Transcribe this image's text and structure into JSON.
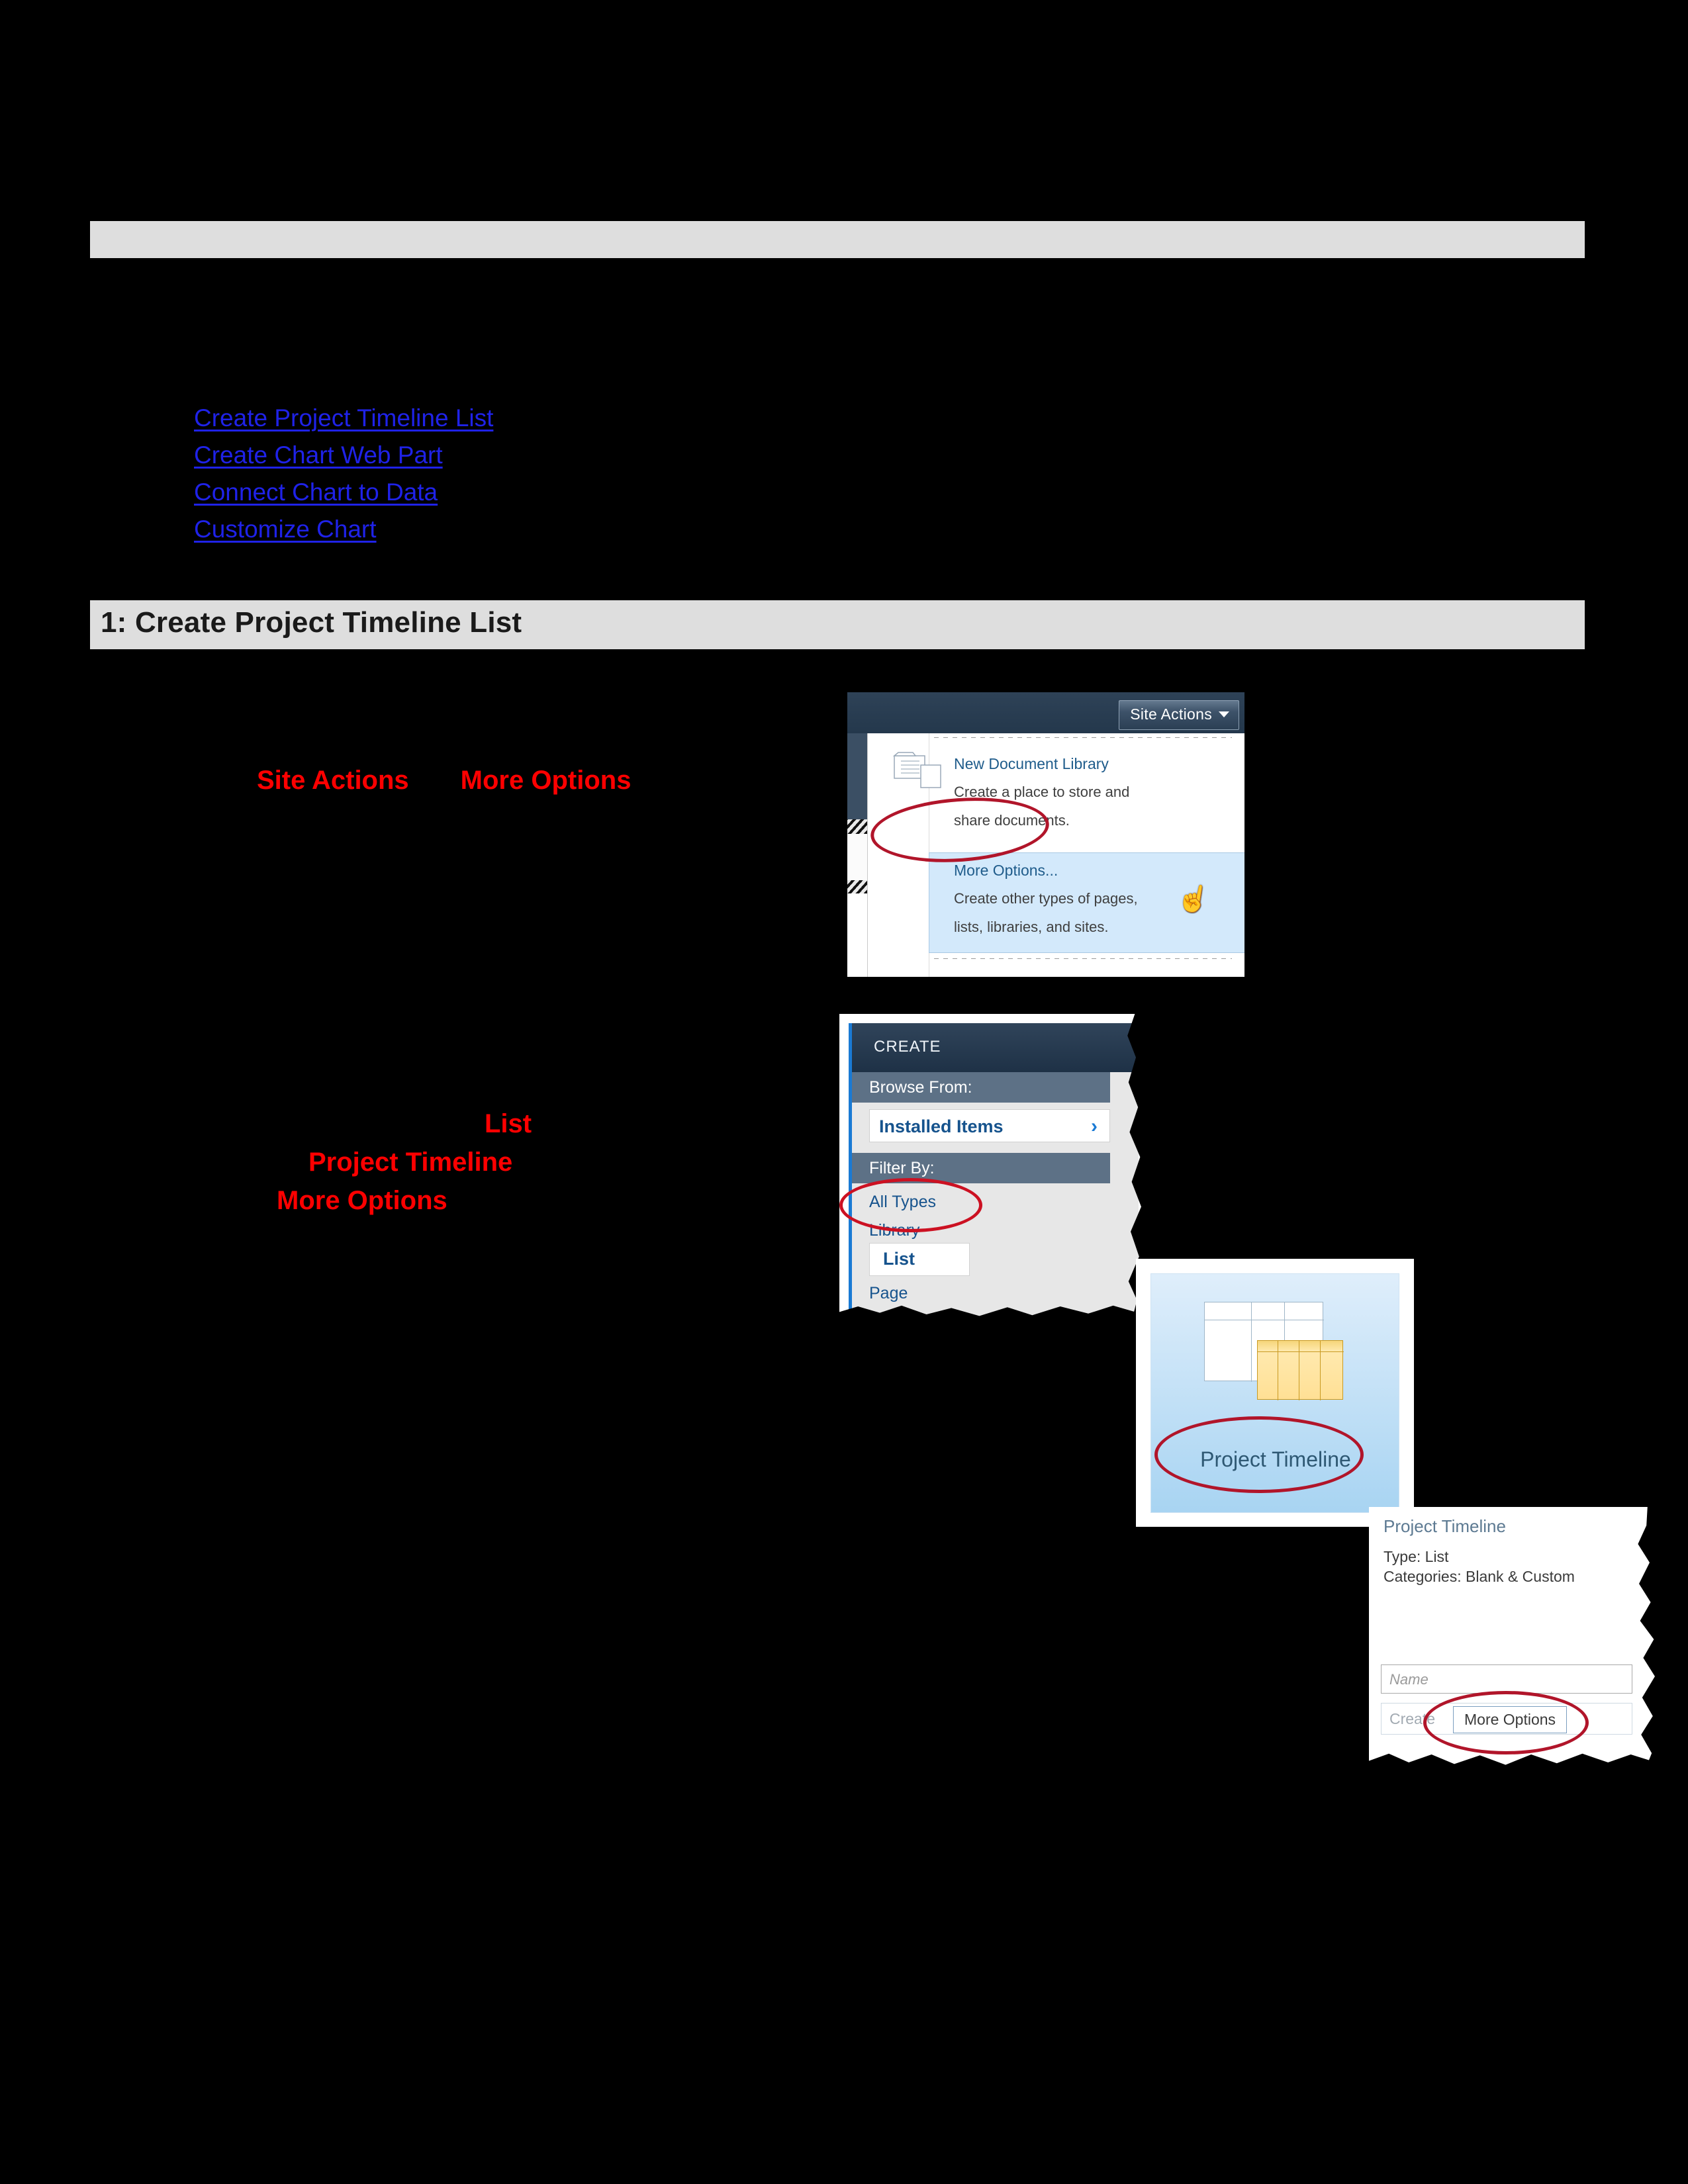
{
  "document": {
    "section_number_title": "1:  Create Project Timeline List",
    "toc_links": [
      "Create Project Timeline List",
      "Create Chart Web Part",
      "Connect Chart to Data",
      "Customize Chart"
    ],
    "annotations": {
      "row1_first": "Site Actions",
      "row1_second": "More Options",
      "row2_line1": "List",
      "row2_line2": "Project Timeline",
      "row2_line3": "More Options"
    },
    "colors": {
      "band_gray": "#dedede",
      "link_blue": "#1f22e8",
      "annotation_red": "#fe0000",
      "circle_red": "#b1152a",
      "page_black": "#000000"
    }
  },
  "screenshot_site_actions": {
    "button_label": "Site Actions",
    "caret_icon": "chevron-down-icon",
    "menu_items": [
      {
        "title": "New Document Library",
        "description_line1": "Create a place to store and",
        "description_line2": "share documents.",
        "icon": "document-library-icon"
      },
      {
        "title": "More Options...",
        "description_line1": "Create other types of pages,",
        "description_line2": "lists, libraries, and sites.",
        "highlighted": true
      }
    ],
    "cursor_icon": "hand-pointer-icon"
  },
  "screenshot_create": {
    "dialog_title": "CREATE",
    "browse_from_label": "Browse From:",
    "installed_items_label": "Installed Items",
    "installed_items_chevron": "chevron-right-icon",
    "filter_by_label": "Filter By:",
    "filter_items": [
      "All Types",
      "Library",
      "List",
      "Page"
    ],
    "selected_filter": "List",
    "tile": {
      "label": "Project Timeline",
      "icon": "project-timeline-tile-icon"
    },
    "details": {
      "title": "Project Timeline",
      "type_line": "Type: List",
      "categories_line": "Categories: Blank & Custom",
      "name_placeholder": "Name",
      "create_button": "Create",
      "more_options_button": "More Options"
    }
  }
}
